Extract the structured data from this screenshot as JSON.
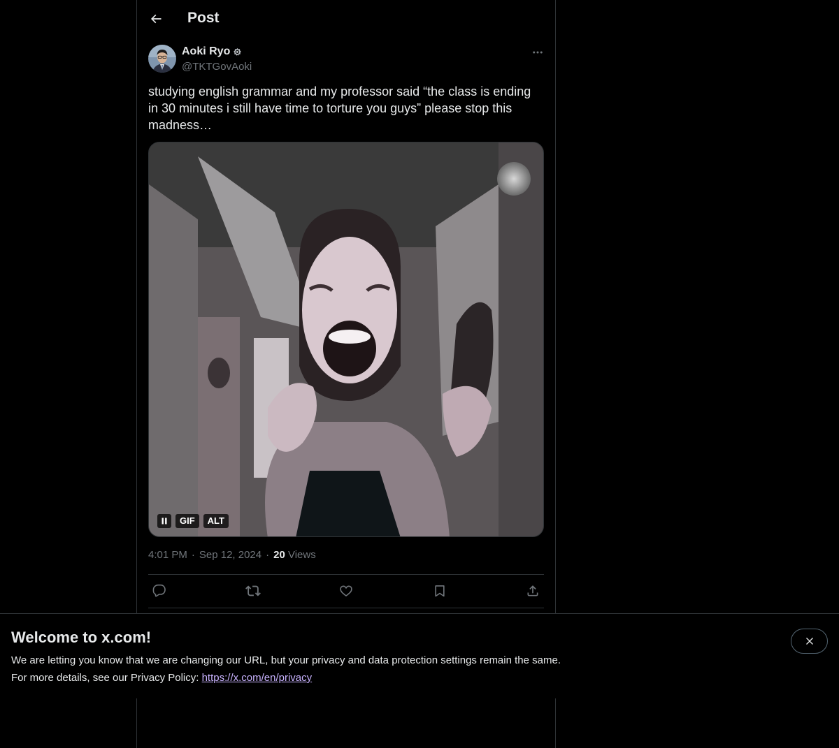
{
  "header": {
    "title": "Post"
  },
  "post": {
    "author_name": "Aoki Ryo",
    "handle": "@TKTGovAoki",
    "text": "studying english grammar and my professor said “the class is ending in 30 minutes i still have time to torture you guys” please stop this madness…",
    "media": {
      "gif_label": "GIF",
      "alt_label": "ALT",
      "playing": true
    },
    "time": "4:01 PM",
    "date": "Sep 12, 2024",
    "views_count": "20",
    "views_label": "Views",
    "separator": "·"
  },
  "banner": {
    "title": "Welcome to x.com!",
    "line1": "We are letting you know that we are changing our URL, but your privacy and data protection settings remain the same.",
    "line2_prefix": "For more details, see our Privacy Policy: ",
    "link_text": "https://x.com/en/privacy"
  },
  "colors": {
    "background": "#000000",
    "text": "#e7e9ea",
    "secondary": "#71767b",
    "border": "#2f3336",
    "link": "#c9b3ff"
  }
}
